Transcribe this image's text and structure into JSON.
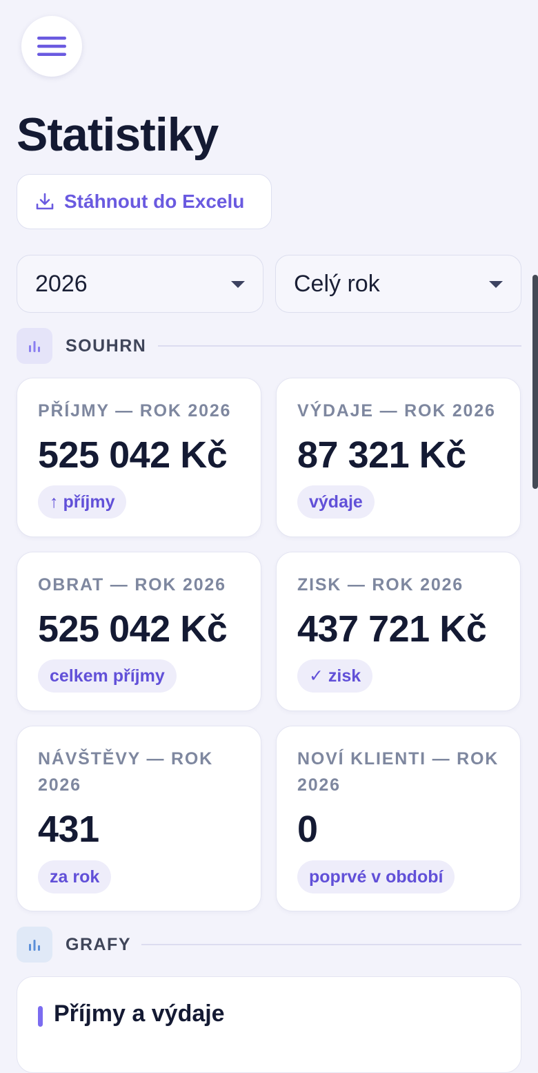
{
  "page": {
    "title": "Statistiky",
    "export_label": "Stáhnout do Excelu",
    "menu_icon": "hamburger-menu-icon"
  },
  "filters": {
    "year": "2026",
    "period": "Celý rok"
  },
  "sections": {
    "summary": "SOUHRN",
    "charts": "GRAFY"
  },
  "cards": [
    {
      "label": "PŘÍJMY — ROK 2026",
      "value": "525 042 Kč",
      "badge": "↑ příjmy"
    },
    {
      "label": "VÝDAJE — ROK 2026",
      "value": "87 321 Kč",
      "badge": "výdaje"
    },
    {
      "label": "OBRAT — ROK 2026",
      "value": "525 042 Kč",
      "badge": "celkem příjmy"
    },
    {
      "label": "ZISK — ROK 2026",
      "value": "437 721 Kč",
      "badge": "✓ zisk"
    },
    {
      "label": "NÁVŠTĚVY — ROK 2026",
      "value": "431",
      "badge": "za rok"
    },
    {
      "label": "NOVÍ KLIENTI — ROK 2026",
      "value": "0",
      "badge": "poprvé v období"
    }
  ],
  "chart_card": {
    "title": "Příjmy a výdaje"
  },
  "colors": {
    "accent": "#6a5ae0",
    "background": "#f3f3fb",
    "text": "#141a33",
    "muted": "#7e879f",
    "badge_bg": "#eeedfa"
  }
}
